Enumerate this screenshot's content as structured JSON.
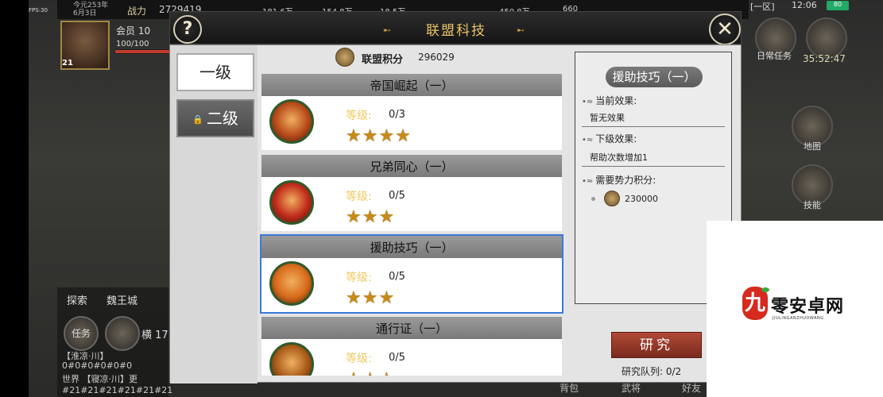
{
  "hud": {
    "fps": "FPS:30",
    "date_line1": "今元253年",
    "date_line2": "6月3日",
    "power_label": "战力",
    "power_value": "2729419",
    "resources": [
      "181.6万",
      "154.8万",
      "18.5万",
      "450.8万",
      "660"
    ],
    "member_label": "会员 10",
    "hp_text": "100/100",
    "level": "21",
    "region": "[一区]",
    "clock": "12:06",
    "battery": "80",
    "daily_task_label": "日常任务",
    "timer": "35:52:47",
    "map_label": "地图",
    "skill_label": "技能",
    "chat_tabs": [
      "探索",
      "魏王城"
    ],
    "task_btn": "任务",
    "chat_name": "横 17",
    "chat_lines": [
      "【淮凉·川】",
      "0#0#0#0#0#0",
      "世界 【寝凉·川】更",
      "#21#21#21#21#21#21"
    ],
    "bottom_labels": [
      "背包",
      "武将",
      "好友"
    ]
  },
  "modal": {
    "title": "联盟科技",
    "help_icon": "?",
    "close_icon": "✕",
    "tabs": [
      {
        "label": "一级",
        "active": true
      },
      {
        "label": "二级",
        "active": false,
        "locked": true
      }
    ],
    "points_label": "联盟积分",
    "points_value": "296029",
    "level_label": "等级:",
    "techs": [
      {
        "name": "帝国崛起（一）",
        "level": "0/3",
        "stars": 4,
        "icon": "fortress-icon",
        "color": "#b84a1a"
      },
      {
        "name": "兄弟同心（一）",
        "level": "0/5",
        "stars": 3,
        "icon": "warriors-icon",
        "color": "#c02a1a"
      },
      {
        "name": "援助技巧（一）",
        "level": "0/5",
        "stars": 3,
        "icon": "fire-hand-icon",
        "color": "#d86a1a",
        "selected": true
      },
      {
        "name": "通行证（一）",
        "level": "0/5",
        "stars": 3,
        "icon": "boots-icon",
        "color": "#a85a18"
      }
    ],
    "detail": {
      "title": "援助技巧（一）",
      "current_label": "当前效果:",
      "current_value": "暂无效果",
      "next_label": "下级效果:",
      "next_value": "帮助次数增加1",
      "cost_label": "需要势力积分:",
      "cost_value": "230000"
    },
    "research_button": "研究",
    "queue_text": "研究队列: 0/2"
  },
  "watermark": {
    "logo_char": "九",
    "name": "零安卓网",
    "sub": "JIULINGANZHUOWANG"
  }
}
